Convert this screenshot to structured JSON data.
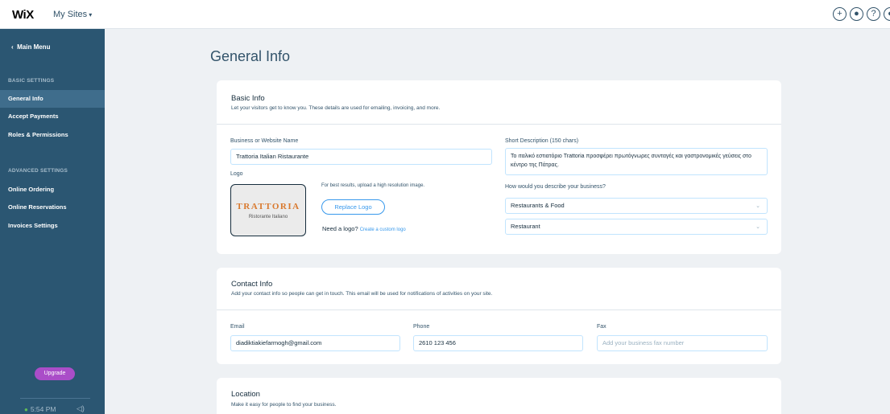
{
  "topbar": {
    "logo": "WiX",
    "my_sites": "My Sites",
    "icons": [
      "plus-icon",
      "bell-icon",
      "help-icon",
      "user-icon"
    ],
    "icon_glyphs": {
      "plus": "+",
      "bell": "●",
      "help": "?",
      "user": "●"
    }
  },
  "sidebar": {
    "main_menu": "Main Menu",
    "basic_heading": "BASIC SETTINGS",
    "basic_items": [
      "General Info",
      "Accept Payments",
      "Roles & Permissions"
    ],
    "advanced_heading": "ADVANCED SETTINGS",
    "advanced_items": [
      "Online Ordering",
      "Online Reservations",
      "Invoices Settings"
    ],
    "upgrade": "Upgrade",
    "time": "5:54 PM"
  },
  "page_title": "General Info",
  "basic_info": {
    "title": "Basic Info",
    "subtitle": "Let your visitors get to know you. These details are used for emailing, invoicing, and more.",
    "business_name_label": "Business or Website Name",
    "business_name_value": "Trattoria Italian Ristaurante",
    "short_desc_label": "Short Description (150 chars)",
    "short_desc_value": "Το ιταλικό εστιατόριο Trattoria προσφέρει πρωτόγνωρες συνταγές και γαστρονομικές γεύσεις στο κέντρο της Πάτρας.",
    "logo_label": "Logo",
    "logo_text_main": "TRATTORIA",
    "logo_text_sub": "Ristorante Italiano",
    "logo_tip": "For best results, upload a high resolution image.",
    "replace_logo": "Replace Logo",
    "need_logo": "Need a logo?",
    "create_logo_link": "Create a custom logo",
    "describe_label": "How would you describe your business?",
    "category_value": "Restaurants & Food",
    "subcategory_value": "Restaurant"
  },
  "contact_info": {
    "title": "Contact Info",
    "subtitle": "Add your contact info so people can get in touch. This email will be used for notifications of activities on your site.",
    "email_label": "Email",
    "email_value": "diadiktiakiefarmogh@gmail.com",
    "phone_label": "Phone",
    "phone_value": "2610 123 456",
    "fax_label": "Fax",
    "fax_placeholder": "Add your business fax number"
  },
  "location": {
    "title": "Location",
    "subtitle": "Make it easy for people to find your business."
  },
  "colors": {
    "sidebar_bg": "#2b5672",
    "sidebar_active": "#3f6d8c",
    "accent": "#3899ec",
    "upgrade": "#aa4dc8"
  }
}
